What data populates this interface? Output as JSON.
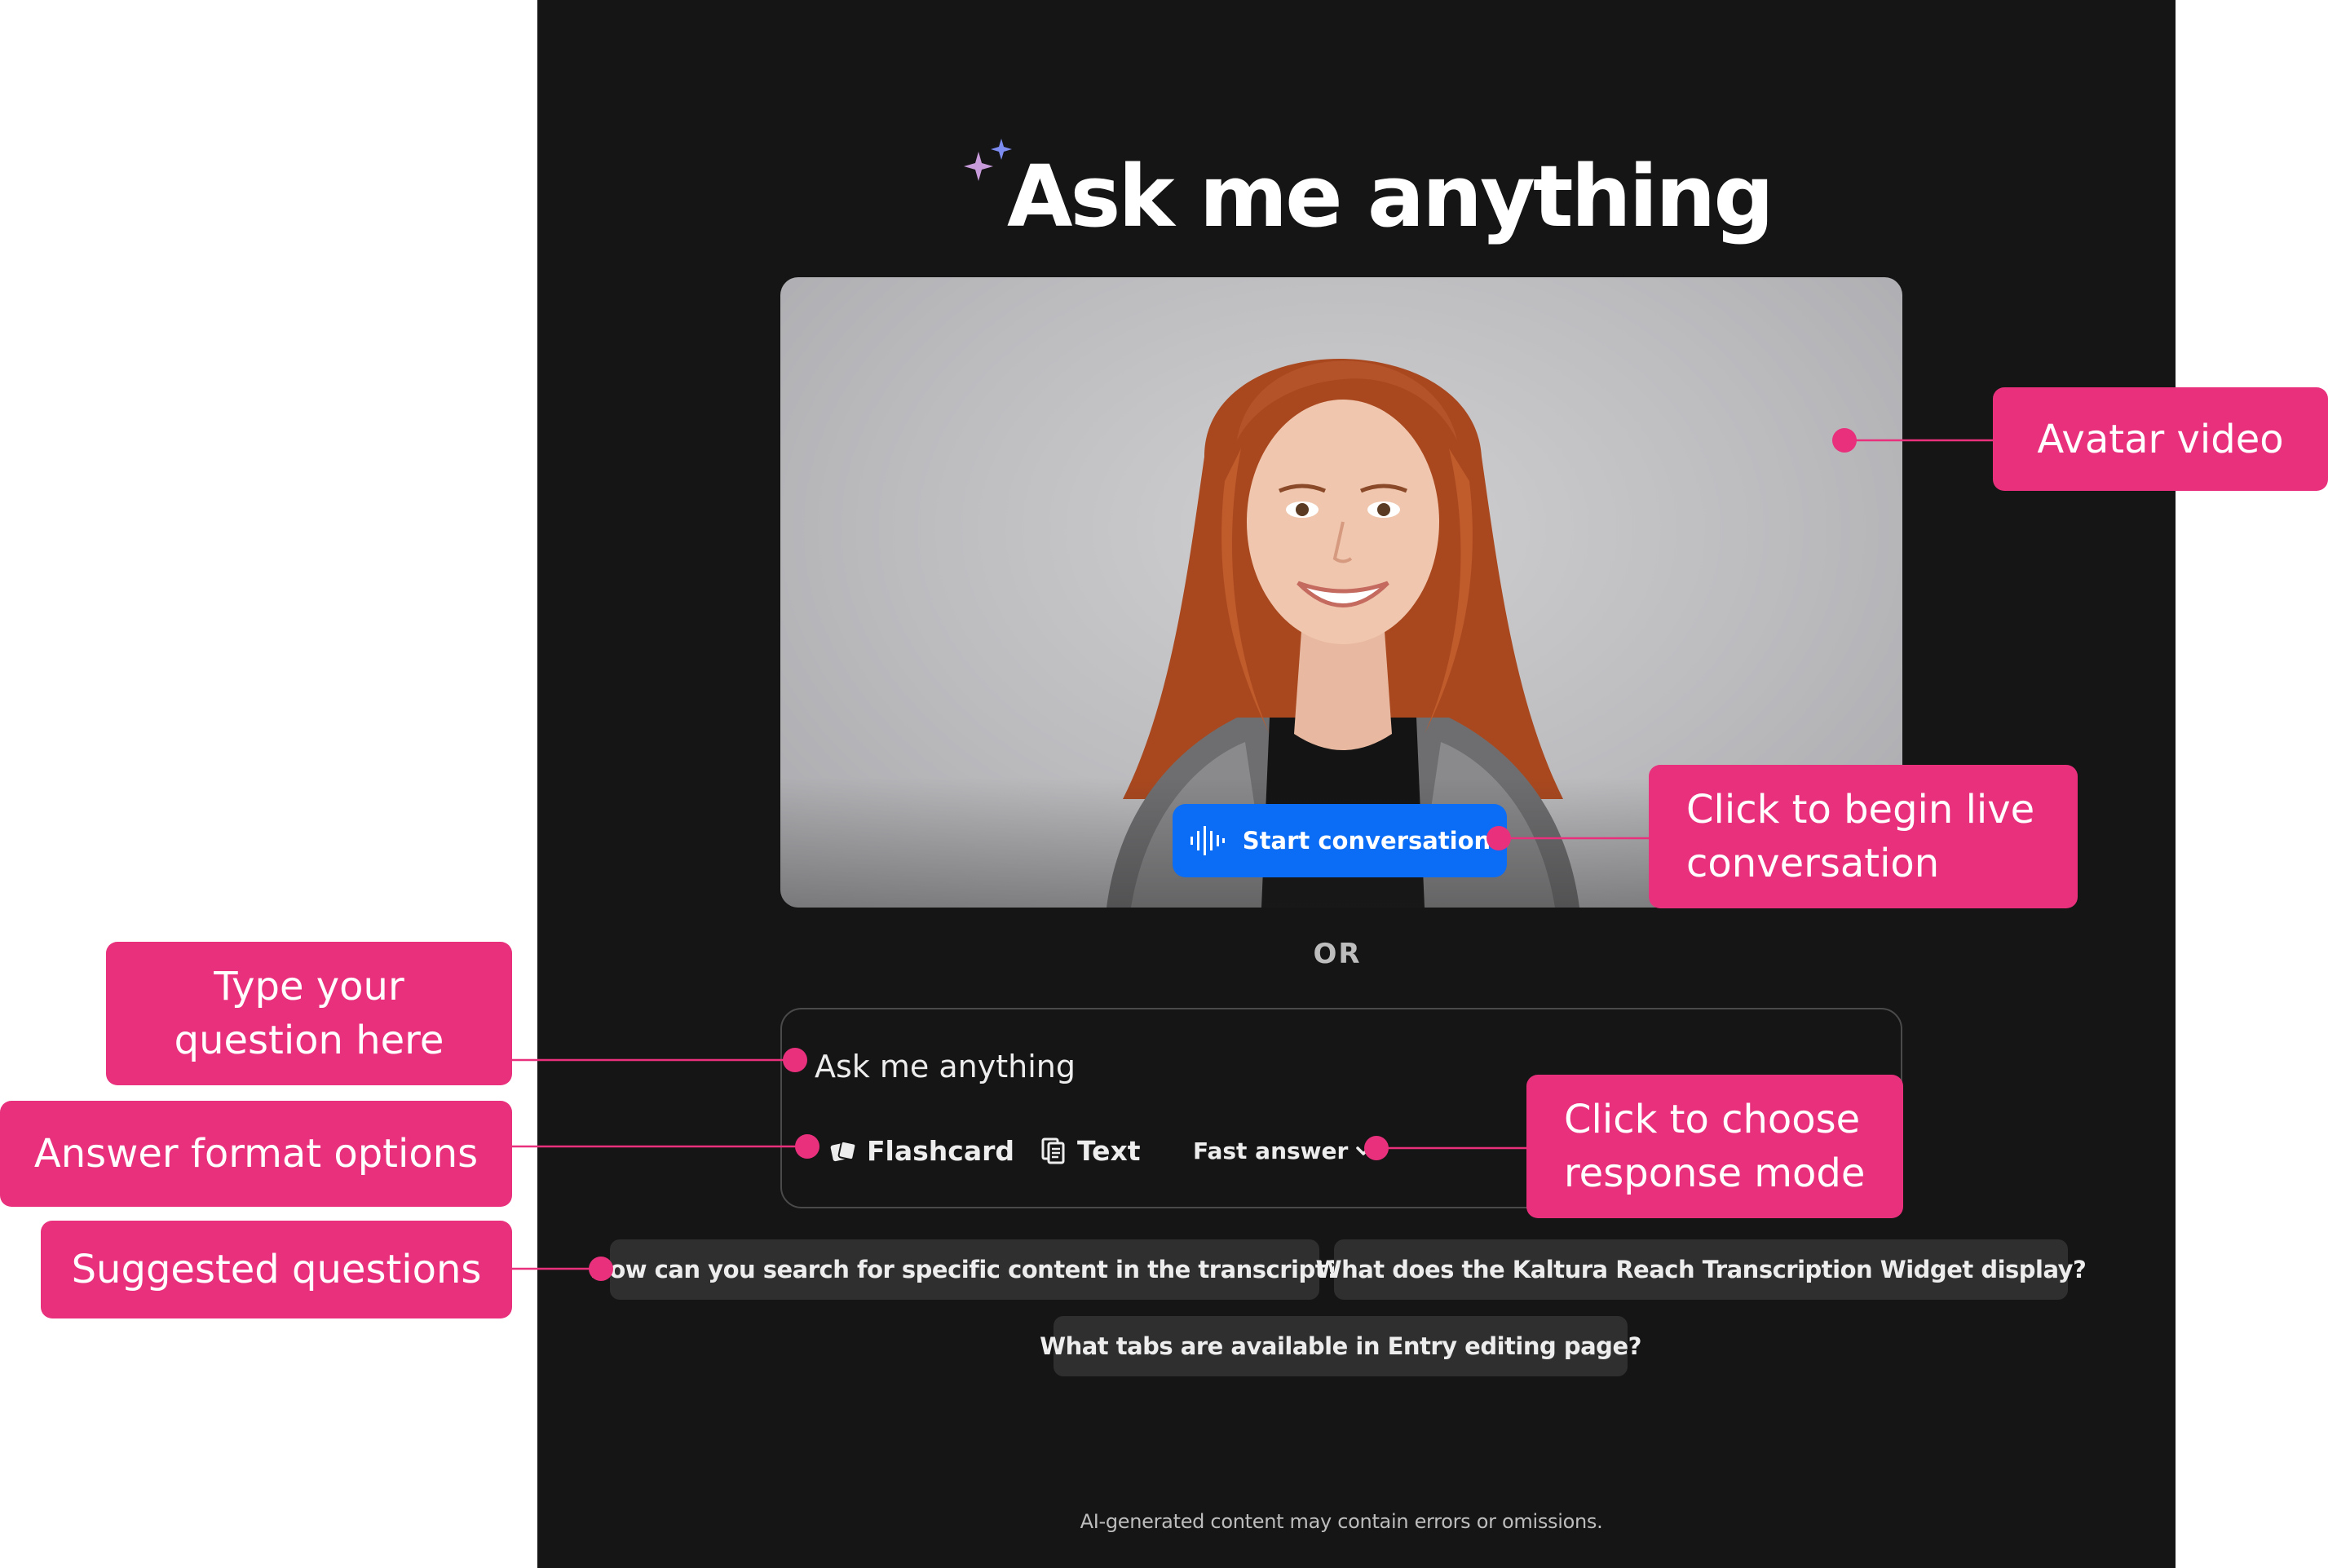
{
  "page": {
    "title": "Ask me anything",
    "or_label": "OR",
    "disclaimer": "AI-generated content may contain errors or omissions."
  },
  "video": {
    "start_button_label": "Start conversation"
  },
  "composer": {
    "placeholder": "Ask me anything",
    "formats": [
      {
        "label": "Flashcard",
        "icon": "flashcard-icon"
      },
      {
        "label": "Text",
        "icon": "text-doc-icon"
      }
    ],
    "mode": {
      "label": "Fast answer",
      "icon": "chevron-down-icon"
    }
  },
  "suggestions": [
    "How can you search for specific content in the transcript?",
    "What does the Kaltura Reach Transcription Widget display?",
    "What tabs are available in Entry editing page?"
  ],
  "annotations": {
    "avatar_video": "Avatar video",
    "begin_live": [
      "Click to begin live",
      "conversation"
    ],
    "type_question": [
      "Type your",
      "question here"
    ],
    "answer_formats": "Answer format options",
    "response_mode": [
      "Click to choose",
      "response mode"
    ],
    "suggested_questions": "Suggested questions"
  },
  "colors": {
    "panel_bg": "#151515",
    "accent_blue": "#0b6cf5",
    "annotation_pink": "#e8307c",
    "chip_bg": "#2f2f2f"
  }
}
